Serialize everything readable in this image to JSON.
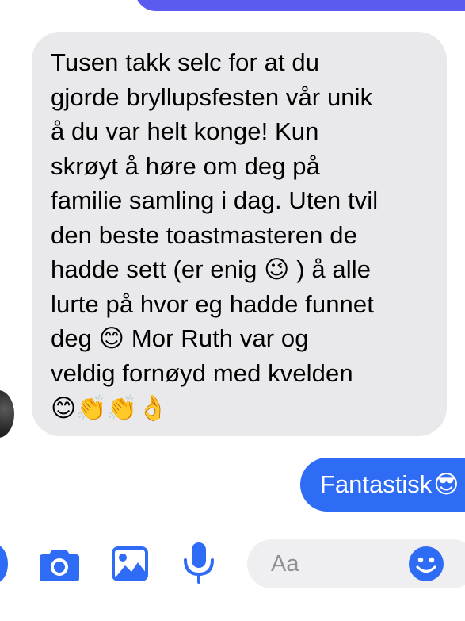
{
  "conversation": {
    "incoming_message": {
      "text": "Tusen takk selc for at du\ngjorde bryllupsfesten vår unik\nå du var helt konge! Kun\nskrøyt å høre om deg på\nfamilie samling i dag. Uten tvil\nden beste toastmasteren de\nhadde sett (er enig 😉 ) å alle\nlurte på hvor eg hadde funnet\ndeg 😊  Mor Ruth var og\nveldig fornøyd med kvelden",
      "emoji_line": "😊👏👏👌"
    },
    "outgoing_message": {
      "text": "Fantastisk",
      "emoji": "😎"
    }
  },
  "composer": {
    "placeholder": "Aa"
  },
  "icons": {
    "plus": "plus-circle-icon",
    "camera": "camera-icon",
    "gallery": "image-icon",
    "microphone": "microphone-icon",
    "emoji": "smiley-emoji-icon"
  },
  "colors": {
    "accent": "#2f6cf5",
    "top_bubble": "#5b5bf0",
    "incoming_bubble": "#e9e9eb",
    "input_background": "#efeff1"
  }
}
